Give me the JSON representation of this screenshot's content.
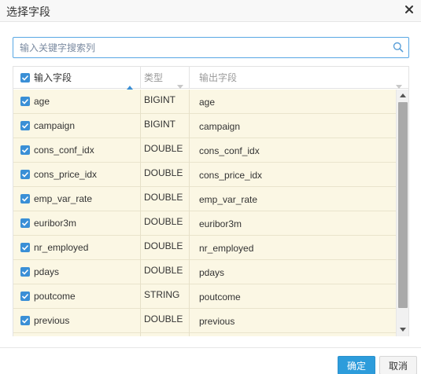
{
  "dialog": {
    "title": "选择字段"
  },
  "search": {
    "placeholder": "输入关键字搜索列"
  },
  "table": {
    "headers": {
      "input_field": "输入字段",
      "type": "类型",
      "output_field": "输出字段"
    },
    "rows": [
      {
        "name": "age",
        "type": "BIGINT",
        "output": "age",
        "checked": true
      },
      {
        "name": "campaign",
        "type": "BIGINT",
        "output": "campaign",
        "checked": true
      },
      {
        "name": "cons_conf_idx",
        "type": "DOUBLE",
        "output": "cons_conf_idx",
        "checked": true
      },
      {
        "name": "cons_price_idx",
        "type": "DOUBLE",
        "output": "cons_price_idx",
        "checked": true
      },
      {
        "name": "emp_var_rate",
        "type": "DOUBLE",
        "output": "emp_var_rate",
        "checked": true
      },
      {
        "name": "euribor3m",
        "type": "DOUBLE",
        "output": "euribor3m",
        "checked": true
      },
      {
        "name": "nr_employed",
        "type": "DOUBLE",
        "output": "nr_employed",
        "checked": true
      },
      {
        "name": "pdays",
        "type": "DOUBLE",
        "output": "pdays",
        "checked": true
      },
      {
        "name": "poutcome",
        "type": "STRING",
        "output": "poutcome",
        "checked": true
      },
      {
        "name": "previous",
        "type": "DOUBLE",
        "output": "previous",
        "checked": true
      }
    ]
  },
  "footer": {
    "ok_label": "确定",
    "cancel_label": "取消"
  },
  "colors": {
    "accent": "#2d9cdb",
    "checkbox": "#3a8fd6",
    "row_bg": "#fbf7e4"
  },
  "icons": {
    "close": "close-icon",
    "search": "search-icon",
    "sort_asc": "sort-asc-icon",
    "sort": "sort-icon",
    "checkbox": "checkbox-checked-icon"
  }
}
